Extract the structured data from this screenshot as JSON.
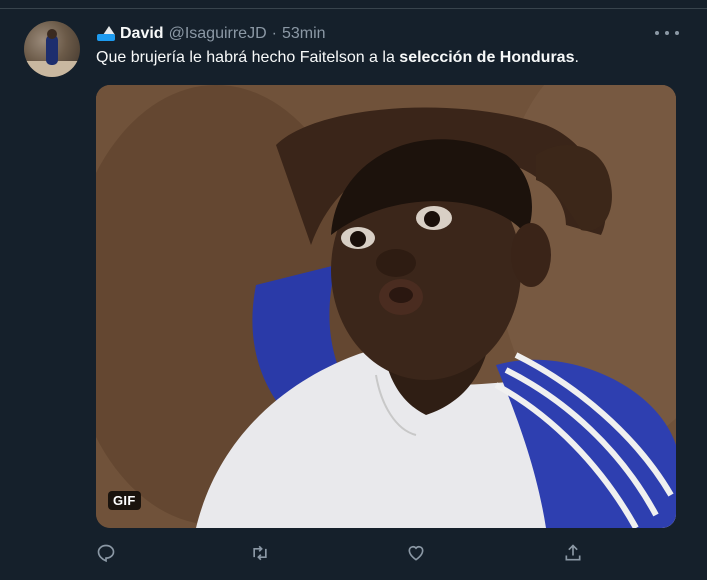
{
  "tweet": {
    "display_name": "David",
    "handle": "@IsaguirreJD",
    "separator": "·",
    "time": "53min",
    "text_prefix": "Que brujería le habrá hecho Faitelson a la ",
    "text_bold": "selección de Honduras",
    "text_suffix": ".",
    "media": {
      "type": "gif",
      "badge": "GIF"
    },
    "actions": [
      "reply-icon",
      "retweet-icon",
      "like-icon",
      "share-icon"
    ]
  },
  "colors": {
    "background": "#15202b",
    "text_primary": "#f7f9f9",
    "text_secondary": "#8b98a5",
    "divider": "#38444d"
  }
}
